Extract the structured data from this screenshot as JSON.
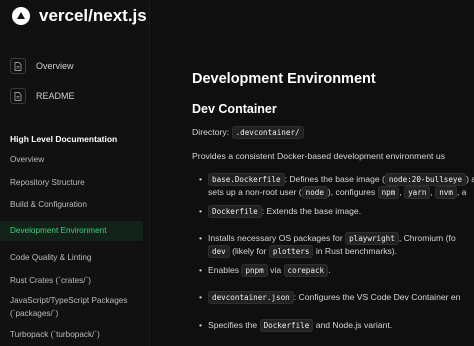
{
  "sidebar": {
    "repo_title": "vercel/next.js",
    "top_items": [
      {
        "label": "Overview",
        "icon": "document-icon"
      },
      {
        "label": "README",
        "icon": "document-icon"
      }
    ],
    "section_title": "High Level Documentation",
    "items": [
      {
        "label": "Overview"
      },
      {
        "label": "Repository Structure"
      },
      {
        "label": "Build & Configuration"
      },
      {
        "label": "Development Environment"
      },
      {
        "label": "Code Quality & Linting"
      },
      {
        "label": "Rust Crates (`crates/`)"
      },
      {
        "label": "JavaScript/TypeScript Packages"
      },
      {
        "label": "(`packages/`)"
      },
      {
        "label": "Turbopack (`turbopack/`)"
      }
    ],
    "active_color": "#3fd07a"
  },
  "content": {
    "title": "Development Environment",
    "subtitle": "Dev Container",
    "directory_label": "Directory:",
    "directory_value": ".devcontainer/",
    "intro": "Provides a consistent Docker-based development environment us",
    "b1": {
      "code": "base.Dockerfile",
      "t1": ": Defines the base image (",
      "code2": "node:20-bullseye",
      "t2": ") a",
      "l2a": "sets up a non-root user (",
      "l2code": "node",
      "l2b": "), configures ",
      "c_npm": "npm",
      "c_yarn": "yarn",
      "c_nvm": "nvm",
      "l2end": ", a"
    },
    "b2": {
      "code": "Dockerfile",
      "text": ": Extends the base image."
    },
    "b3": {
      "t1": "Installs necessary OS packages for ",
      "code": "playwright",
      "t2": ", Chromium (fo",
      "l2code": "dev",
      "l2a": " (likely for ",
      "l2code2": "plotters",
      "l2b": " in Rust benchmarks)."
    },
    "b4": {
      "t1": "Enables ",
      "code": "pnpm",
      "t2": " via ",
      "code2": "corepack",
      "t3": "."
    },
    "b5": {
      "code": "devcontainer.json",
      "text": ": Configures the VS Code Dev Container en"
    },
    "b6": {
      "t1": "Specifies the ",
      "code": "Dockerfile",
      "t2": " and Node.js variant."
    }
  }
}
